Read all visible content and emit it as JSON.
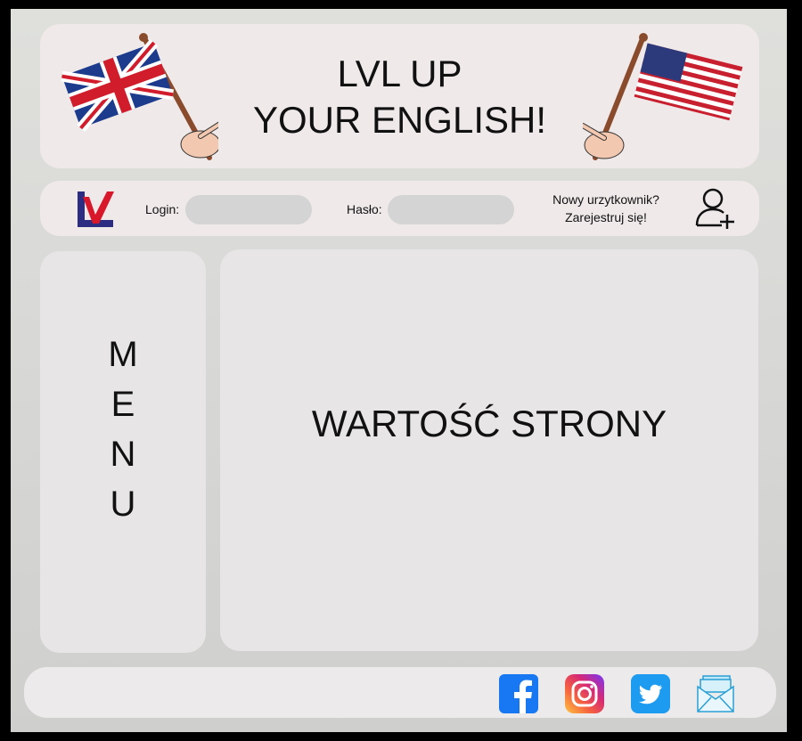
{
  "header": {
    "title_line1": "LVL UP",
    "title_line2": "YOUR ENGLISH!",
    "left_flag_icon": "uk-flag-icon",
    "right_flag_icon": "us-flag-icon"
  },
  "login_bar": {
    "logo_icon": "lvl-logo-icon",
    "login_label": "Login:",
    "login_value": "",
    "password_label": "Hasło:",
    "password_value": "",
    "register_line1": "Nowy urzytkownik?",
    "register_line2": "Zarejestruj się!",
    "add_user_icon": "add-user-icon"
  },
  "menu": {
    "letters": [
      "M",
      "E",
      "N",
      "U"
    ]
  },
  "content": {
    "title": "WARTOŚĆ STRONY"
  },
  "footer": {
    "social_icons": [
      "facebook-icon",
      "instagram-icon",
      "twitter-icon",
      "mail-icon"
    ]
  },
  "colors": {
    "panel": "#efe9ea",
    "field": "#d4d4d4",
    "logo_red": "#d8172b",
    "logo_blue": "#2b2c82",
    "facebook": "#1877f2",
    "twitter": "#1d9bf0"
  }
}
